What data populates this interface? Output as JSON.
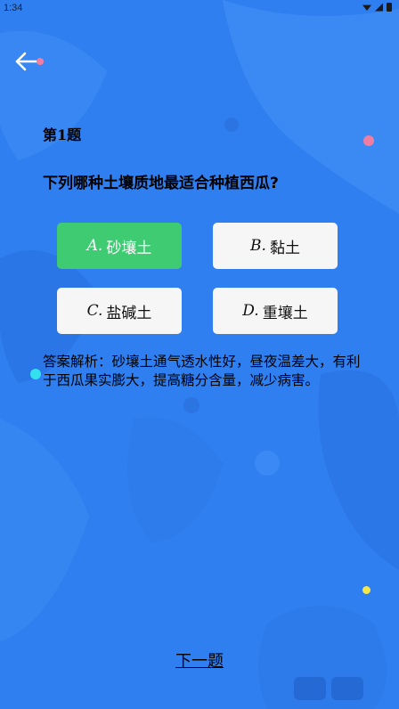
{
  "status_bar": {
    "time": "1:34"
  },
  "colors": {
    "background": "#2f7ff0",
    "correct_option": "#3ecb72",
    "option_bg": "#f6f6f6"
  },
  "header": {
    "back_icon": "arrow-left-icon"
  },
  "question": {
    "number_label": "第1题",
    "text": "下列哪种土壤质地最适合种植西瓜?"
  },
  "options": [
    {
      "letter": "A.",
      "label": "砂壤土",
      "state": "correct"
    },
    {
      "letter": "B.",
      "label": "黏土",
      "state": "normal"
    },
    {
      "letter": "C.",
      "label": "盐碱土",
      "state": "normal"
    },
    {
      "letter": "D.",
      "label": "重壤土",
      "state": "normal"
    }
  ],
  "analysis": {
    "text": "答案解析：砂壤土通气透水性好，昼夜温差大，有利于西瓜果实膨大，提高糖分含量，减少病害。"
  },
  "footer": {
    "next_label": "下一题"
  }
}
